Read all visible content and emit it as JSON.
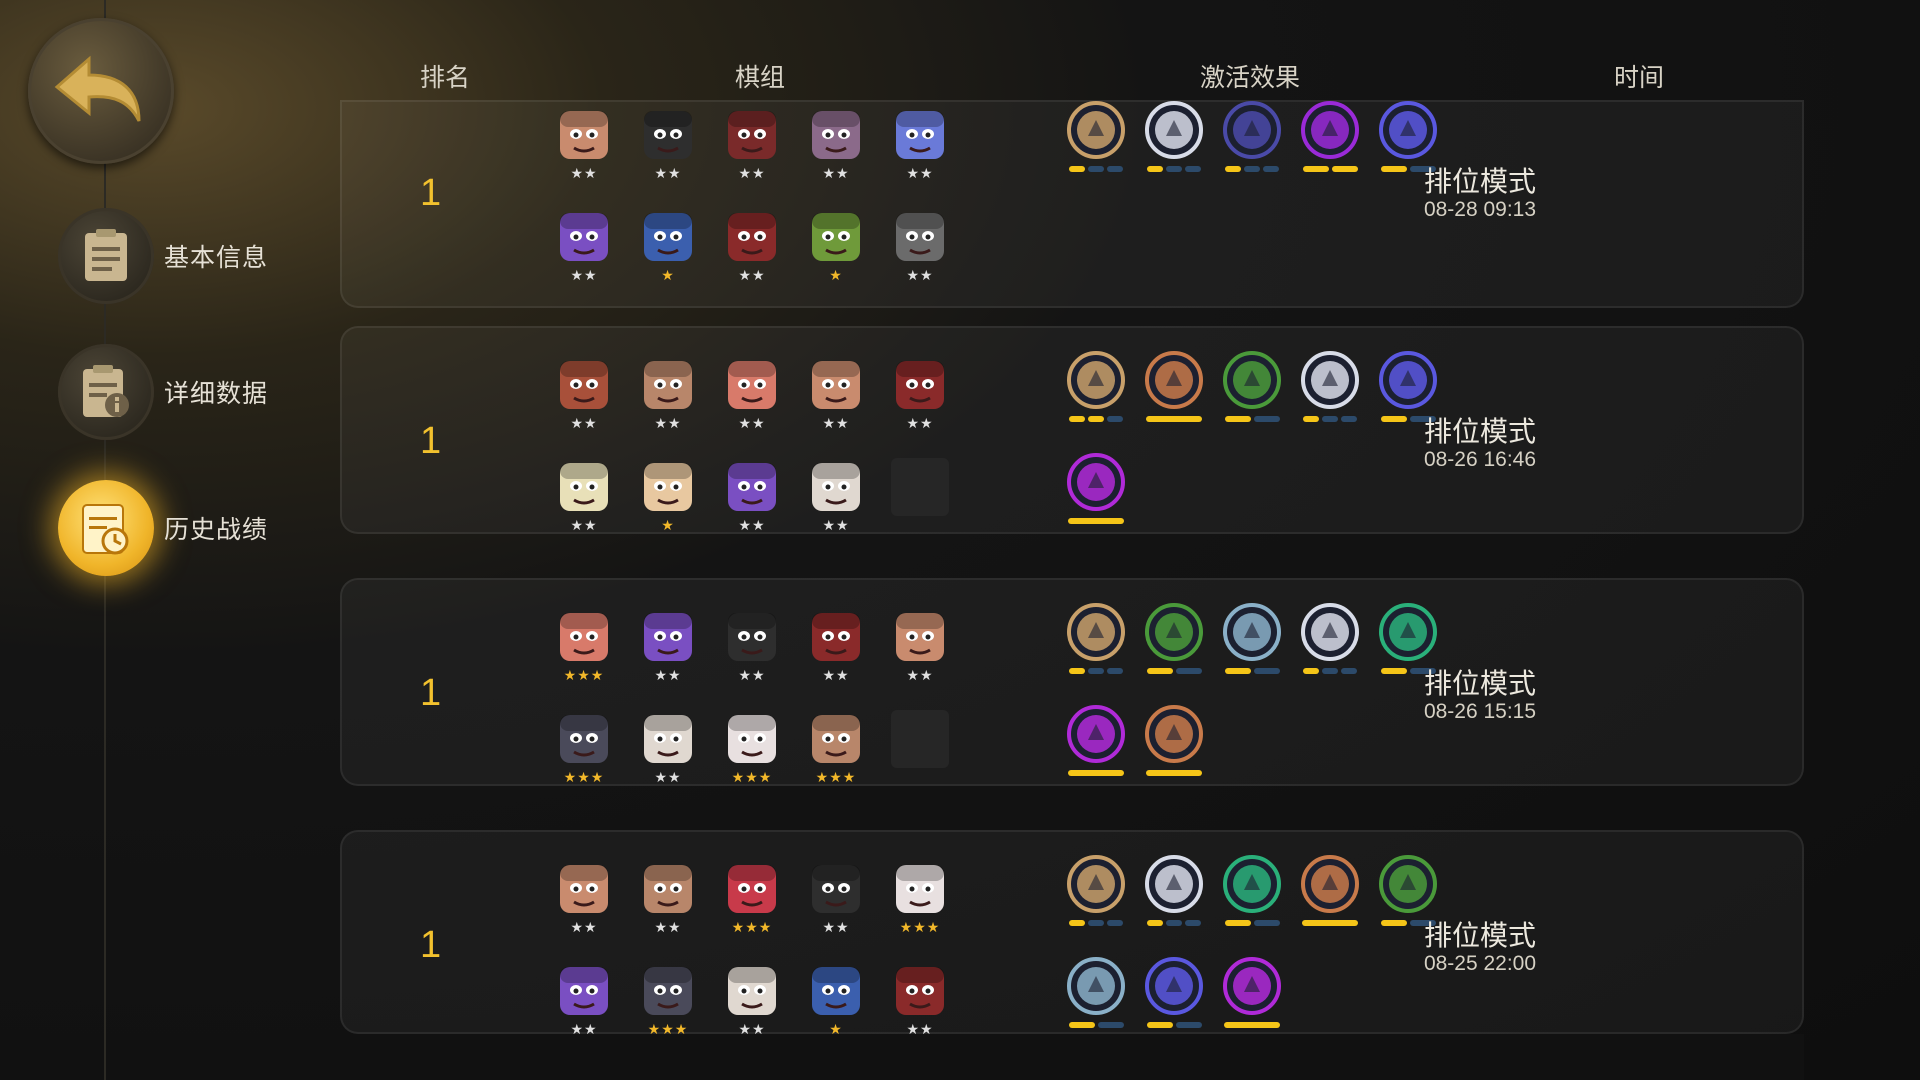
{
  "nav": {
    "items": [
      {
        "label": "基本信息",
        "icon": "document-icon",
        "active": false
      },
      {
        "label": "详细数据",
        "icon": "info-document-icon",
        "active": false
      },
      {
        "label": "历史战绩",
        "icon": "history-clock-icon",
        "active": true
      }
    ]
  },
  "headers": {
    "rank": "排名",
    "lineup": "棋组",
    "traits": "激活效果",
    "time": "时间"
  },
  "colors": {
    "accent": "#f2c12e",
    "bar_on": "#f5c518",
    "bar_off": "#2c4a6a",
    "star_gold": "#f2b82a",
    "star_silver": "#e0e0e0"
  },
  "matches": [
    {
      "rank": "1",
      "mode": "排位模式",
      "date": "08-28 09:13",
      "row1": [
        {
          "name": "bulldog-hero",
          "color": "#c98b6e",
          "stars": 2
        },
        {
          "name": "hooded-ninja-hero",
          "color": "#2e2e2e",
          "stars": 2
        },
        {
          "name": "fox-mask-hero",
          "color": "#7a2a2a",
          "stars": 2
        },
        {
          "name": "silver-hair-hero",
          "color": "#8b6a8a",
          "stars": 2
        },
        {
          "name": "blue-robot-hero",
          "color": "#6a7ad8",
          "stars": 2
        }
      ],
      "row2": [
        {
          "name": "purple-hair-hero",
          "color": "#7a4fc2",
          "stars": 2
        },
        {
          "name": "blue-hair-hero",
          "color": "#3b5fae",
          "stars": 1
        },
        {
          "name": "red-hat-bandit-hero",
          "color": "#8a2a2a",
          "stars": 2
        },
        {
          "name": "goblin-hero",
          "color": "#6f9a3a",
          "stars": 1
        },
        {
          "name": "gray-skull-hero",
          "color": "#6b6b6b",
          "stars": 2
        }
      ],
      "traits1": [
        {
          "name": "axe-trait-icon",
          "color": "#c8a06a",
          "segs": 3,
          "on": 1
        },
        {
          "name": "knight-trait-icon",
          "color": "#d8dce8",
          "segs": 3,
          "on": 1
        },
        {
          "name": "laptop-trait-icon",
          "color": "#4a4aa8",
          "segs": 3,
          "on": 1
        },
        {
          "name": "demon-mage-trait-icon",
          "color": "#9a2ad8",
          "segs": 2,
          "on": 2
        },
        {
          "name": "fishbone-trait-icon",
          "color": "#5a58e0",
          "segs": 2,
          "on": 1
        }
      ],
      "traits2": []
    },
    {
      "rank": "1",
      "mode": "排位模式",
      "date": "08-26 16:46",
      "row1": [
        {
          "name": "masked-warrior-hero",
          "color": "#a8503a",
          "stars": 2
        },
        {
          "name": "sunglasses-hero",
          "color": "#b8866a",
          "stars": 2
        },
        {
          "name": "white-hair-hero",
          "color": "#d87a6a",
          "stars": 2
        },
        {
          "name": "bulldog-hero",
          "color": "#c98b6e",
          "stars": 2
        },
        {
          "name": "red-hat-bandit-hero",
          "color": "#8a2a2a",
          "stars": 2
        }
      ],
      "row2": [
        {
          "name": "blue-cap-hero",
          "color": "#e8e0b8",
          "stars": 2
        },
        {
          "name": "cat-hero",
          "color": "#e8c8a0",
          "stars": 1
        },
        {
          "name": "purple-hair-hero",
          "color": "#7a4fc2",
          "stars": 2
        },
        {
          "name": "skull-face-hero",
          "color": "#e0d8d0",
          "stars": 2
        },
        {
          "name": "empty",
          "color": "",
          "stars": 0
        }
      ],
      "traits1": [
        {
          "name": "axe-trait-icon",
          "color": "#c8a06a",
          "segs": 3,
          "on": 2
        },
        {
          "name": "horned-helmet-trait-icon",
          "color": "#c87a4a",
          "segs": 1,
          "on": 1
        },
        {
          "name": "bow-trait-icon",
          "color": "#4a9a3a",
          "segs": 2,
          "on": 1
        },
        {
          "name": "knight-trait-icon",
          "color": "#d8dce8",
          "segs": 3,
          "on": 1
        },
        {
          "name": "fishbone-trait-icon",
          "color": "#5a58e0",
          "segs": 2,
          "on": 1
        }
      ],
      "traits2": [
        {
          "name": "purple-demon-trait-icon",
          "color": "#b02ad8",
          "segs": 1,
          "on": 1
        }
      ]
    },
    {
      "rank": "1",
      "mode": "排位模式",
      "date": "08-26 15:15",
      "row1": [
        {
          "name": "white-hair-hero",
          "color": "#d87a6a",
          "stars": 3
        },
        {
          "name": "purple-hair-hero",
          "color": "#7a4fc2",
          "stars": 2
        },
        {
          "name": "hooded-ninja-hero",
          "color": "#2e2e2e",
          "stars": 2
        },
        {
          "name": "red-hat-bandit-hero",
          "color": "#8a2a2a",
          "stars": 2
        },
        {
          "name": "bulldog-hero",
          "color": "#c98b6e",
          "stars": 2
        }
      ],
      "row2": [
        {
          "name": "dark-hood-hero",
          "color": "#4a4a5a",
          "stars": 3
        },
        {
          "name": "skull-face-hero",
          "color": "#e0d8d0",
          "stars": 2
        },
        {
          "name": "white-bird-hero",
          "color": "#e8e0e0",
          "stars": 3
        },
        {
          "name": "sunglasses-hero",
          "color": "#b8866a",
          "stars": 3
        },
        {
          "name": "empty",
          "color": "",
          "stars": 0
        }
      ],
      "traits1": [
        {
          "name": "axe-trait-icon",
          "color": "#c8a06a",
          "segs": 3,
          "on": 1
        },
        {
          "name": "bow-trait-icon",
          "color": "#4a9a3a",
          "segs": 2,
          "on": 1
        },
        {
          "name": "fist-trait-icon",
          "color": "#8ab0c8",
          "segs": 2,
          "on": 1
        },
        {
          "name": "knight-trait-icon",
          "color": "#d8dce8",
          "segs": 3,
          "on": 1
        },
        {
          "name": "paw-trait-icon",
          "color": "#2ab07a",
          "segs": 2,
          "on": 1
        }
      ],
      "traits2": [
        {
          "name": "purple-demon-trait-icon",
          "color": "#b02ad8",
          "segs": 1,
          "on": 1
        },
        {
          "name": "horned-helmet-trait-icon",
          "color": "#c87a4a",
          "segs": 1,
          "on": 1
        }
      ]
    },
    {
      "rank": "1",
      "mode": "排位模式",
      "date": "08-25 22:00",
      "row1": [
        {
          "name": "bulldog-hero",
          "color": "#c98b6e",
          "stars": 2
        },
        {
          "name": "sunglasses-hero",
          "color": "#b8866a",
          "stars": 2
        },
        {
          "name": "red-demon-hero",
          "color": "#c83a4a",
          "stars": 3
        },
        {
          "name": "hooded-ninja-hero",
          "color": "#2e2e2e",
          "stars": 2
        },
        {
          "name": "white-bird-hero",
          "color": "#e8e0e0",
          "stars": 3
        }
      ],
      "row2": [
        {
          "name": "purple-hair-hero",
          "color": "#7a4fc2",
          "stars": 2
        },
        {
          "name": "dark-hood-hero",
          "color": "#4a4a5a",
          "stars": 3
        },
        {
          "name": "skull-face-hero",
          "color": "#e0d8d0",
          "stars": 2
        },
        {
          "name": "blue-hair-hero",
          "color": "#3b5fae",
          "stars": 1
        },
        {
          "name": "red-hat-bandit-hero",
          "color": "#8a2a2a",
          "stars": 2
        }
      ],
      "traits1": [
        {
          "name": "axe-trait-icon",
          "color": "#c8a06a",
          "segs": 3,
          "on": 1
        },
        {
          "name": "knight-trait-icon",
          "color": "#d8dce8",
          "segs": 3,
          "on": 1
        },
        {
          "name": "paw-trait-icon",
          "color": "#2ab07a",
          "segs": 2,
          "on": 1
        },
        {
          "name": "horned-helmet-trait-icon",
          "color": "#c87a4a",
          "segs": 1,
          "on": 1
        },
        {
          "name": "bow-trait-icon",
          "color": "#4a9a3a",
          "segs": 2,
          "on": 1
        }
      ],
      "traits2": [
        {
          "name": "fist-trait-icon",
          "color": "#8ab0c8",
          "segs": 2,
          "on": 1
        },
        {
          "name": "fishbone-trait-icon",
          "color": "#5a58e0",
          "segs": 2,
          "on": 1
        },
        {
          "name": "purple-demon-trait-icon",
          "color": "#b02ad8",
          "segs": 1,
          "on": 1
        }
      ]
    }
  ]
}
